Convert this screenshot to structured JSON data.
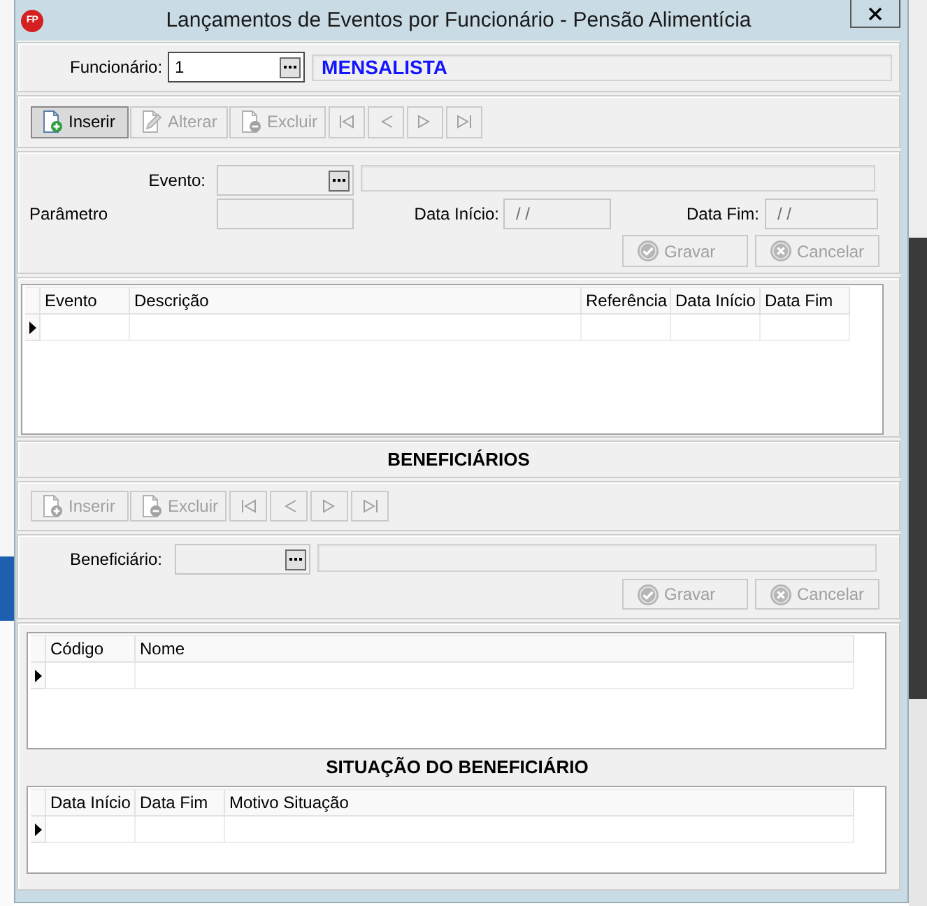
{
  "window": {
    "icon_label": "FP",
    "title": "Lançamentos de Eventos por Funcionário - Pensão Alimentícia"
  },
  "employee": {
    "label": "Funcionário:",
    "code": "1",
    "disabled": false,
    "name": "MENSALISTA"
  },
  "event_toolbar": {
    "actions": [
      {
        "kind": "insert",
        "label": "Inserir",
        "disabled": false,
        "focused": true
      },
      {
        "kind": "edit",
        "label": "Alterar",
        "disabled": true,
        "focused": false
      },
      {
        "kind": "delete",
        "label": "Excluir",
        "disabled": true,
        "focused": false
      }
    ],
    "navigation": [
      {
        "kind": "first",
        "disabled": true
      },
      {
        "kind": "previous",
        "disabled": true
      },
      {
        "kind": "next",
        "disabled": true
      },
      {
        "kind": "last",
        "disabled": true
      }
    ]
  },
  "event_form": {
    "event": {
      "label": "Evento:",
      "disabled": true
    },
    "parameter": {
      "label": "Parâmetro",
      "disabled": true
    },
    "start_date": {
      "label": "Data Início:",
      "value": "/ /",
      "disabled": true
    },
    "end_date": {
      "label": "Data Fim:",
      "value": "/ /",
      "disabled": true
    },
    "buttons": [
      {
        "kind": "save",
        "label": "Gravar",
        "disabled": true
      },
      {
        "kind": "cancel",
        "label": "Cancelar",
        "disabled": true
      }
    ]
  },
  "events_table": {
    "columns": [
      "Evento",
      "Descrição",
      "Referência",
      "Data Início",
      "Data Fim"
    ],
    "rows": [
      {
        "current": true
      }
    ]
  },
  "beneficiaries": {
    "title": "BENEFICIÁRIOS",
    "toolbar": {
      "actions": [
        {
          "kind": "insert",
          "label": "Inserir",
          "disabled": true,
          "focused": false
        },
        {
          "kind": "delete",
          "label": "Excluir",
          "disabled": true,
          "focused": false
        }
      ],
      "navigation": [
        {
          "kind": "first",
          "disabled": true
        },
        {
          "kind": "previous",
          "disabled": true
        },
        {
          "kind": "next",
          "disabled": true
        },
        {
          "kind": "last",
          "disabled": true
        }
      ]
    },
    "form": {
      "beneficiary": {
        "label": "Beneficiário:",
        "disabled": true
      },
      "buttons": [
        {
          "kind": "save",
          "label": "Gravar",
          "disabled": true
        },
        {
          "kind": "cancel",
          "label": "Cancelar",
          "disabled": true
        }
      ]
    },
    "table": {
      "columns": [
        "Código",
        "Nome"
      ],
      "rows": [
        {
          "current": true
        }
      ]
    }
  },
  "beneficiary_status": {
    "title": "SITUAÇÃO DO BENEFICIÁRIO",
    "table": {
      "columns": [
        "Data Início",
        "Data Fim",
        "Motivo Situação"
      ],
      "rows": [
        {
          "current": true
        }
      ]
    }
  }
}
